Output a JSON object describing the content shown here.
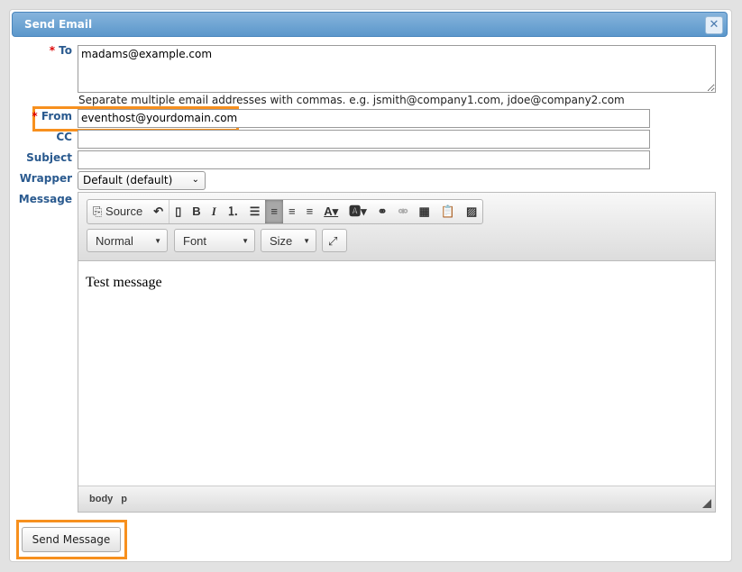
{
  "dialog": {
    "title": "Send Email",
    "close": "✕"
  },
  "form": {
    "required_mark": "*",
    "to_label": "To",
    "to_value": "madams@example.com",
    "hint": "Separate multiple email addresses with commas. e.g. jsmith@company1.com, jdoe@company2.com",
    "from_label": "From",
    "from_value": "eventhost@yourdomain.com",
    "cc_label": "CC",
    "cc_value": "",
    "subject_label": "Subject",
    "subject_value": "",
    "wrapper_label": "Wrapper",
    "wrapper_value": "Default (default)",
    "message_label": "Message"
  },
  "editor": {
    "source": "Source",
    "format": "Normal",
    "font": "Font",
    "size": "Size",
    "content": "Test message",
    "path": [
      "body",
      "p"
    ]
  },
  "send_button": "Send Message",
  "colors": {
    "highlight": "#f7901e",
    "header": "#5b97cb"
  }
}
